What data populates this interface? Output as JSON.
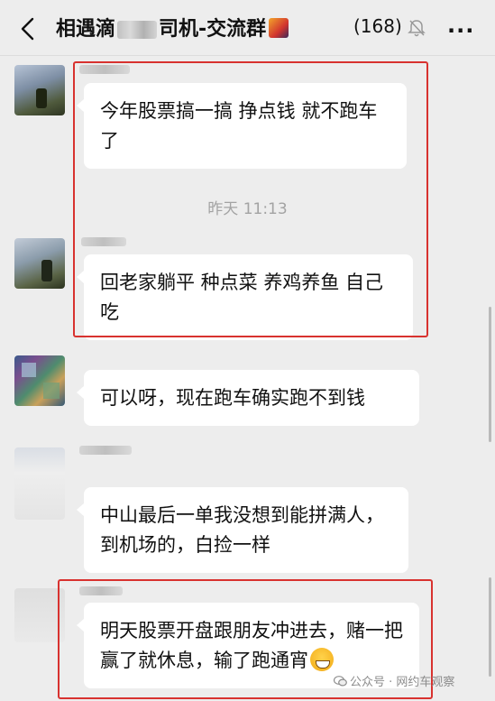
{
  "header": {
    "title_start": "相遇滴",
    "title_end": "司机-交流群",
    "member_count": "(168)",
    "more_label": "···"
  },
  "timestamp": "昨天 11:13",
  "messages": [
    {
      "text": "今年股票搞一搞 挣点钱 就不跑车了"
    },
    {
      "text": "回老家躺平 种点菜 养鸡养鱼 自己吃"
    },
    {
      "text": "可以呀，现在跑车确实跑不到钱"
    },
    {
      "text": "中山最后一单我没想到能拼满人，到机场的，白捡一样"
    },
    {
      "text": "明天股票开盘跟朋友冲进去，赌一把赢了就休息，输了跑通宵"
    }
  ],
  "watermark": "公众号 · 网约车观察",
  "colors": {
    "background": "#ededed",
    "bubble": "#ffffff",
    "highlight_box": "#d8322f",
    "timestamp": "#a3a3a3"
  },
  "icons": {
    "back": "chevron-left-icon",
    "mute": "bell-muted-icon",
    "more": "more-dots-icon",
    "emoji": "grinning-emoji-icon"
  }
}
